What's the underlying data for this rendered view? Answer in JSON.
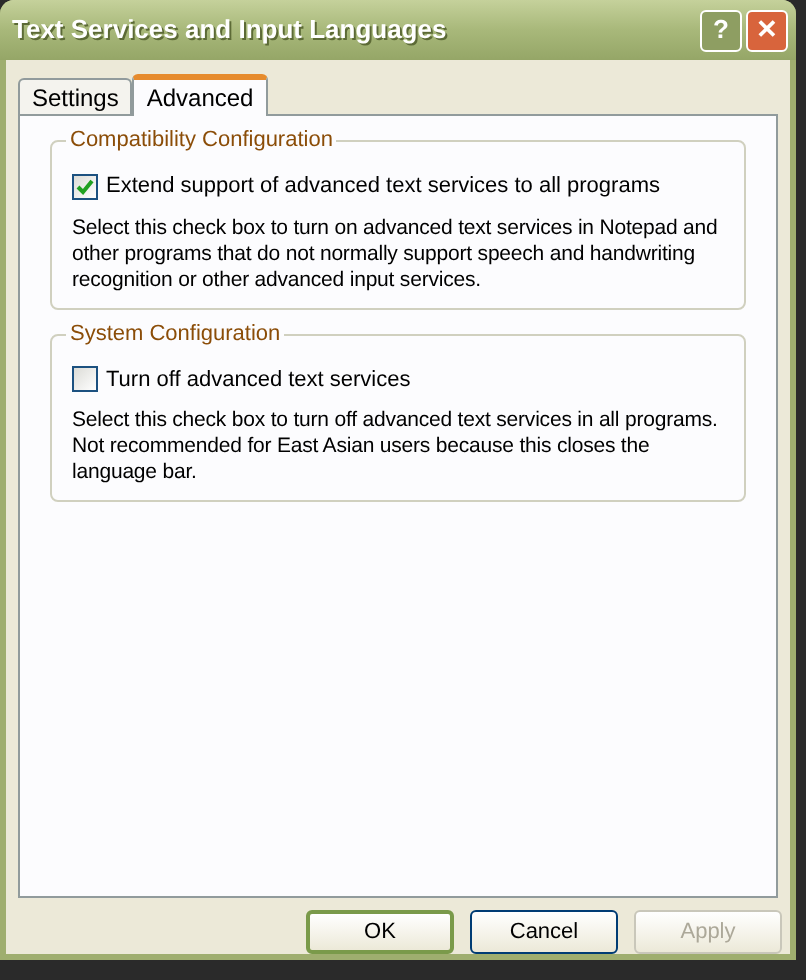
{
  "window": {
    "title": "Text Services and Input Languages"
  },
  "title_buttons": [
    {
      "kind": "help",
      "label": "?"
    },
    {
      "kind": "close",
      "label": "✕"
    }
  ],
  "tabs": [
    {
      "label": "Settings",
      "selected": false
    },
    {
      "label": "Advanced",
      "selected": true
    }
  ],
  "groups": [
    {
      "title": "Compatibility Configuration",
      "checkbox": {
        "label": "Extend support of advanced text services to all programs",
        "checked": true
      },
      "description": "Select this check box to turn on advanced text services in Notepad and other programs that do not normally support speech and handwriting recognition or other advanced input services."
    },
    {
      "title": "System Configuration",
      "checkbox": {
        "label": "Turn off advanced text services",
        "checked": false
      },
      "description": "Select this check box to turn off advanced text services in all programs. Not recommended for East Asian users because this closes the language bar."
    }
  ],
  "buttons": [
    {
      "label": "OK",
      "disabled": false,
      "default": true
    },
    {
      "label": "Cancel",
      "disabled": false,
      "default": false
    },
    {
      "label": "Apply",
      "disabled": true,
      "default": false
    }
  ]
}
